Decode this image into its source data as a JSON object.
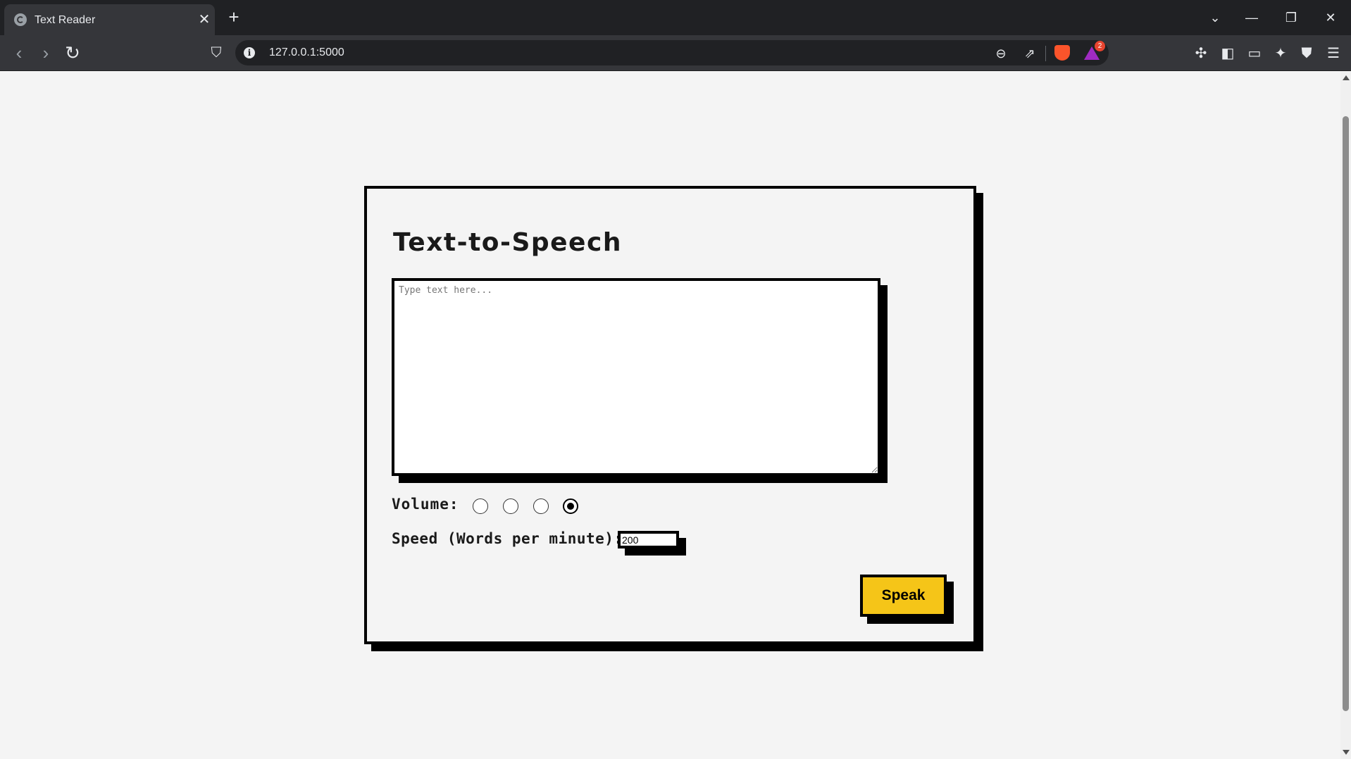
{
  "browser": {
    "tab_title": "Text Reader",
    "tab_close": "✕",
    "new_tab": "+",
    "url": "127.0.0.1:5000",
    "rewards_badge": "2"
  },
  "page": {
    "title": "Text-to-Speech",
    "textarea_placeholder": "Type text here...",
    "volume_label": "Volume:",
    "volume_selected": 4,
    "volume_options": 4,
    "speed_label": "Speed (Words per minute):",
    "speed_value": "200",
    "speak_label": "Speak"
  },
  "colors": {
    "accent": "#f5c518",
    "border": "#000000",
    "background": "#f4f4f4"
  }
}
